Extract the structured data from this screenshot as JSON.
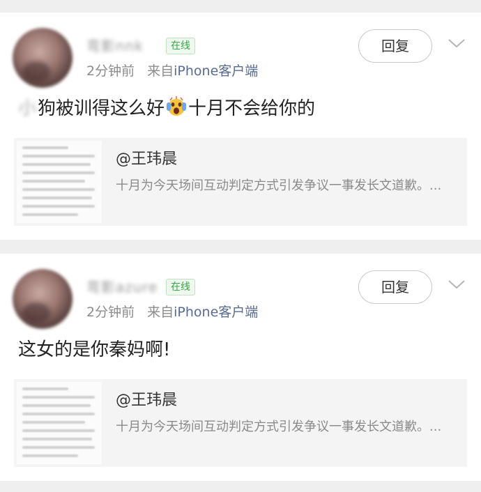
{
  "comments": [
    {
      "username": "弯影nnk",
      "online_badge": "在线",
      "time": "2分钟前",
      "source_prefix": "来自",
      "device": "iPhone客户端",
      "reply_label": "回复",
      "text_blurred": "小",
      "text_before_emoji": "狗被训得这么好",
      "emoji": "screaming-face-emoji",
      "text_after_emoji": "十月不会给你的",
      "quote": {
        "author": "@王玮晨",
        "summary": "十月为今天场间互动判定方式引发争议一事发长文道歉。..."
      }
    },
    {
      "username": "弯影azure",
      "online_badge": "在线",
      "time": "2分钟前",
      "source_prefix": "来自",
      "device": "iPhone客户端",
      "reply_label": "回复",
      "text": "这女的是你秦妈啊!",
      "quote": {
        "author": "@王玮晨",
        "summary": "十月为今天场间互动判定方式引发争议一事发长文道歉。..."
      }
    }
  ],
  "colors": {
    "background": "#efefef",
    "online_green": "#36a844",
    "device_blue": "#576b95",
    "meta_gray": "#8c8c8c"
  }
}
